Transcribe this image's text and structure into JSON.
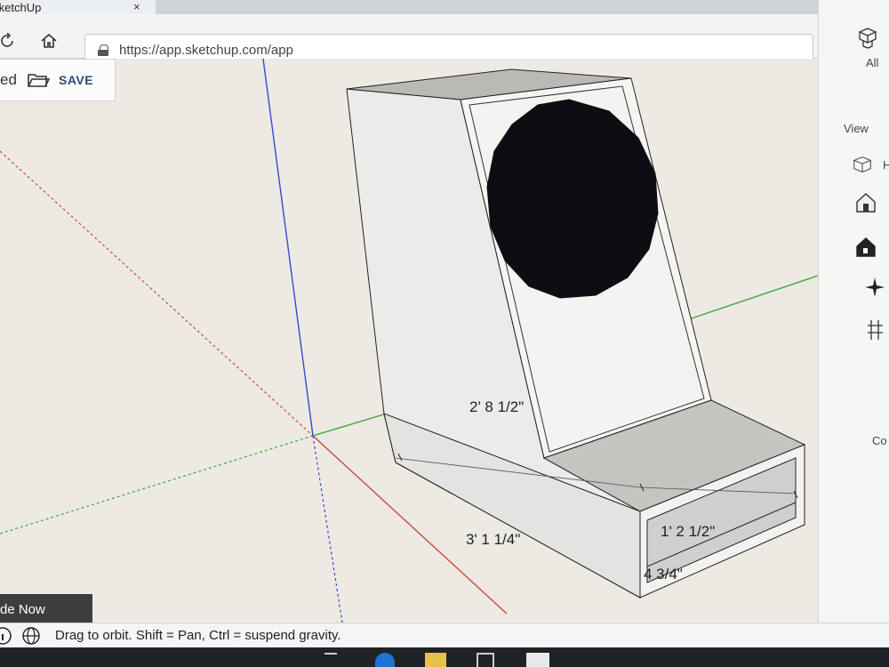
{
  "browser": {
    "tab_title": "SketchUp",
    "tab_close": "×",
    "url": "https://app.sketchup.com/app"
  },
  "file_toolbar": {
    "dirty_suffix": "ed",
    "save_label": "SAVE"
  },
  "right_panel": {
    "all_label": "All",
    "view_label": "View",
    "partial_label_1": "H",
    "partial_label_2": "Co"
  },
  "model": {
    "dimensions": [
      "2' 8 1/2\"",
      "3' 1 1/4\"",
      "1' 2 1/2\"",
      "4 3/4\""
    ]
  },
  "trade_button": {
    "label": "de Now"
  },
  "status_bar": {
    "hint": "Drag to orbit. Shift = Pan, Ctrl = suspend gravity."
  },
  "colors": {
    "accent": "#2d4a77",
    "canvas": "#eceae3",
    "red_axis": "#d0453a",
    "green_axis": "#3fa53a",
    "blue_axis": "#3a48c8"
  },
  "icons": [
    "refresh-icon",
    "home-icon",
    "lock-icon",
    "folder-icon",
    "globe-icon",
    "components-icon",
    "iso-view-icon",
    "home-view-icon",
    "house-view-icon",
    "perspective-icon",
    "section-icon"
  ]
}
